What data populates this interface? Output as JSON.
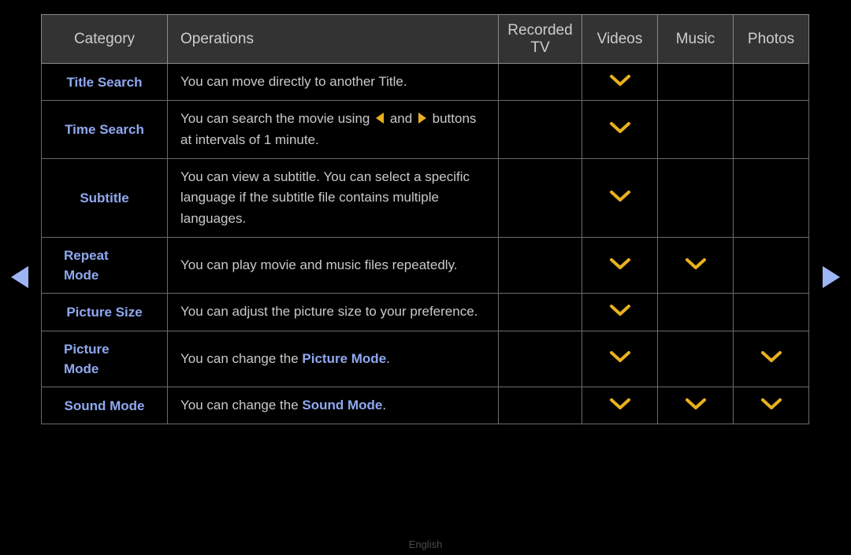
{
  "nav": {
    "prev_label": "Previous page",
    "next_label": "Next page"
  },
  "table": {
    "headers": {
      "category": "Category",
      "operations": "Operations",
      "recorded_tv": "Recorded\nTV",
      "recorded_tv_line1": "Recorded",
      "recorded_tv_line2": "TV",
      "videos": "Videos",
      "music": "Music",
      "photos": "Photos"
    },
    "mark_icon": "chevron-down-icon",
    "mark_color": "#e8b11e",
    "rows": [
      {
        "category": "Title Search",
        "category_lines": [
          "Title Search"
        ],
        "operations_text": "You can move directly to another Title.",
        "recorded_tv": false,
        "videos": true,
        "music": false,
        "photos": false
      },
      {
        "category": "Time Search",
        "category_lines": [
          "Time Search"
        ],
        "operations_text": "You can search the movie using ◀ and ▶ buttons at intervals of 1 minute.",
        "operations_part1": "You can search the movie using",
        "operations_part2": "and",
        "operations_part3": "buttons at intervals of 1 minute.",
        "recorded_tv": false,
        "videos": true,
        "music": false,
        "photos": false
      },
      {
        "category": "Subtitle",
        "category_lines": [
          "Subtitle"
        ],
        "operations_text": "You can view a subtitle. You can select a specific language if the subtitle file contains multiple languages.",
        "recorded_tv": false,
        "videos": true,
        "music": false,
        "photos": false
      },
      {
        "category": "Repeat Mode",
        "category_lines": [
          "Repeat",
          "Mode"
        ],
        "operations_text": "You can play movie and music files repeatedly.",
        "recorded_tv": false,
        "videos": true,
        "music": true,
        "photos": false
      },
      {
        "category": "Picture Size",
        "category_lines": [
          "Picture Size"
        ],
        "operations_text": "You can adjust the picture size to your preference.",
        "recorded_tv": false,
        "videos": true,
        "music": false,
        "photos": false
      },
      {
        "category": "Picture Mode",
        "category_lines": [
          "Picture",
          "Mode"
        ],
        "operations_text": "You can change the Picture Mode.",
        "operations_prefix": "You can change the ",
        "operations_term": "Picture Mode",
        "operations_suffix": ".",
        "recorded_tv": false,
        "videos": true,
        "music": false,
        "photos": true
      },
      {
        "category": "Sound Mode",
        "category_lines": [
          "Sound Mode"
        ],
        "operations_text": "You can change the Sound Mode.",
        "operations_prefix": "You can change the ",
        "operations_term": "Sound Mode",
        "operations_suffix": ".",
        "recorded_tv": false,
        "videos": true,
        "music": true,
        "photos": true
      }
    ]
  },
  "footer": {
    "language": "English"
  }
}
